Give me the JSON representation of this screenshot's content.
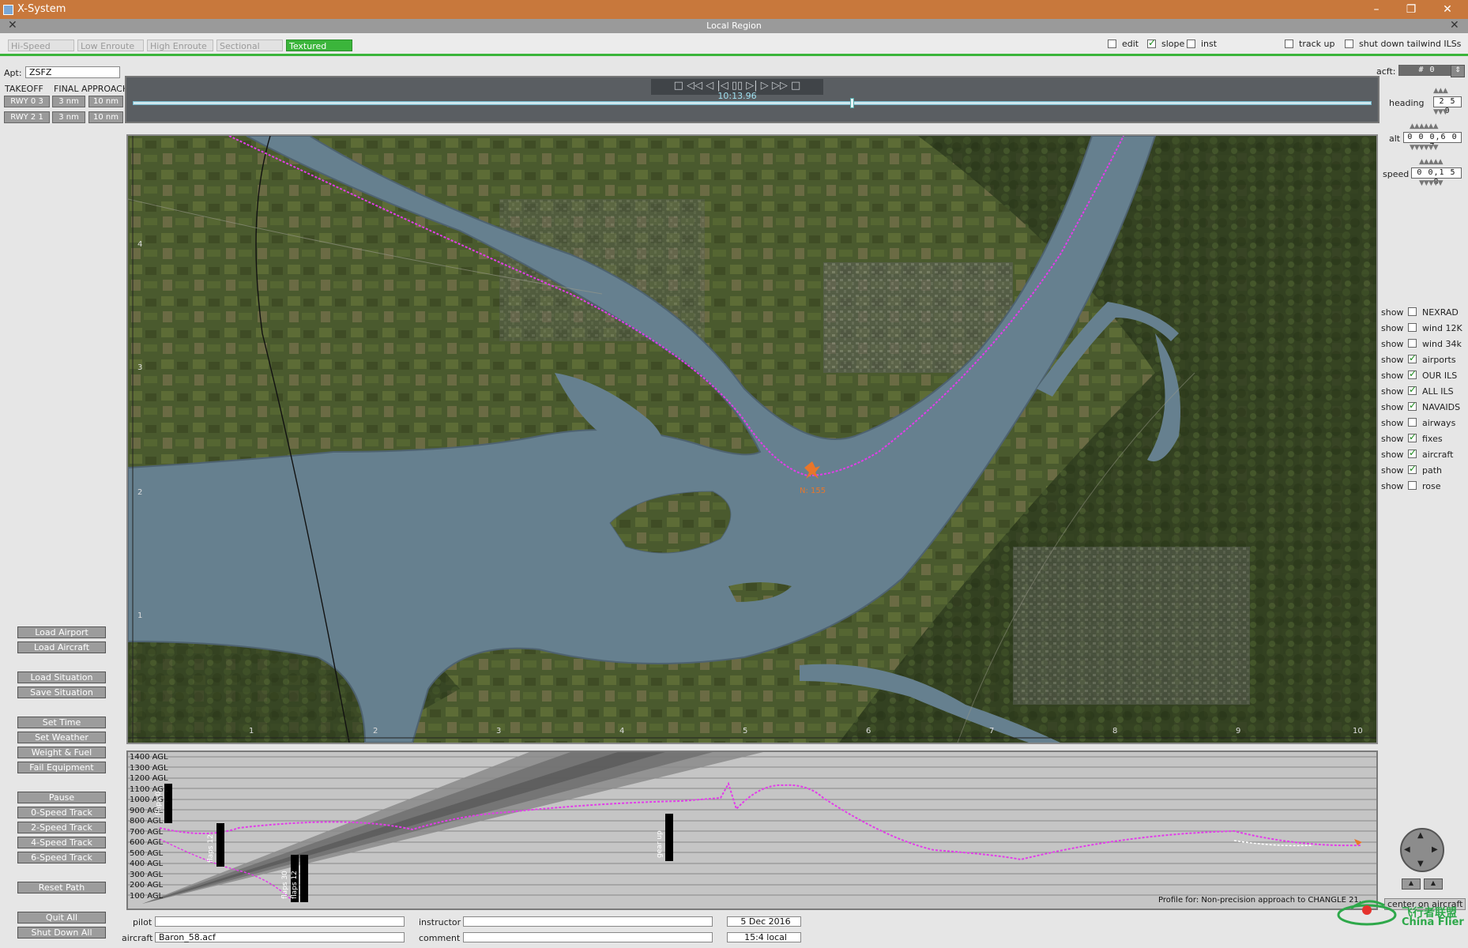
{
  "window": {
    "title": "X-System",
    "subtitle": "Local Region"
  },
  "map_tabs": [
    {
      "label": "Hi-Speed",
      "active": false
    },
    {
      "label": "Low Enroute",
      "active": false
    },
    {
      "label": "High Enroute",
      "active": false
    },
    {
      "label": "Sectional",
      "active": false
    },
    {
      "label": "Textured",
      "active": true
    }
  ],
  "top_options": [
    {
      "label": "edit",
      "checked": false
    },
    {
      "label": "slope",
      "checked": true
    },
    {
      "label": "inst",
      "checked": false
    },
    {
      "label": "track up",
      "checked": false
    },
    {
      "label": "shut down tailwind ILSs",
      "checked": false
    }
  ],
  "left": {
    "apt_label": "Apt:",
    "apt_value": "ZSFZ",
    "col_takeoff": "TAKEOFF",
    "col_final": "FINAL APPROACH",
    "runways": [
      {
        "rwy": "RWY 0 3",
        "a": "3 nm",
        "b": "10 nm"
      },
      {
        "rwy": "RWY 2 1",
        "a": "3 nm",
        "b": "10 nm"
      }
    ],
    "buttons": [
      "Load Airport",
      "Load Aircraft",
      "Load Situation",
      "Save Situation",
      "Set Time",
      "Set Weather",
      "Weight & Fuel",
      "Fail Equipment",
      "Pause",
      "0-Speed Track",
      "2-Speed Track",
      "4-Speed Track",
      "6-Speed Track",
      "Reset Path",
      "Quit All",
      "Shut Down All"
    ]
  },
  "timeline": {
    "clock": "10:13.96",
    "controls": "□ ◁◁ ◁ |◁ ▯▯ ▷| ▷ ▷▷ □"
  },
  "right": {
    "acft_label": "acft:",
    "acft_value": "# 0",
    "heading_label": "heading",
    "heading_value": "2 5 0",
    "alt_label": "alt",
    "alt_value": "0 0 0,6 0 7",
    "speed_label": "speed",
    "speed_value": "0 0,1 5 8",
    "show_word": "show",
    "layers": [
      {
        "label": "NEXRAD",
        "checked": false
      },
      {
        "label": "wind 12K",
        "checked": false
      },
      {
        "label": "wind 34k",
        "checked": false
      },
      {
        "label": "airports",
        "checked": true
      },
      {
        "label": "OUR ILS",
        "checked": true
      },
      {
        "label": "ALL ILS",
        "checked": true
      },
      {
        "label": "NAVAIDS",
        "checked": true
      },
      {
        "label": "airways",
        "checked": false
      },
      {
        "label": "fixes",
        "checked": true
      },
      {
        "label": "aircraft",
        "checked": true
      },
      {
        "label": "path",
        "checked": true
      },
      {
        "label": "rose",
        "checked": false
      }
    ],
    "center_btn": "center on aircraft"
  },
  "map": {
    "x_ticks": [
      "1",
      "2",
      "3",
      "4",
      "5",
      "6",
      "7",
      "8",
      "9",
      "10"
    ],
    "y_ticks": [
      "4",
      "3",
      "2",
      "1"
    ],
    "aircraft_label": "N: 155"
  },
  "profile": {
    "agl_labels": [
      "1400 AGL",
      "1300 AGL",
      "1200 AGL",
      "1100 AGL",
      "1000 AGL",
      "900 AGL",
      "800 AGL",
      "700 AGL",
      "600 AGL",
      "500 AGL",
      "400 AGL",
      "300 AGL",
      "200 AGL",
      "100 AGL"
    ],
    "events": [
      "flaps 0",
      "flaps 12",
      "flaps 30",
      "flaps 12",
      "gear up"
    ],
    "caption": "Profile for: Non-precision approach to CHANGLE 21."
  },
  "footer": {
    "pilot_label": "pilot",
    "pilot_value": "",
    "instructor_label": "instructor",
    "instructor_value": "",
    "date": "5 Dec  2016",
    "aircraft_label": "aircraft",
    "aircraft_value": "Baron_58.acf",
    "comment_label": "comment",
    "comment_value": "",
    "time": "15:4 local"
  },
  "watermark": {
    "line1": "飞行者联盟",
    "line2": "China Flier"
  }
}
